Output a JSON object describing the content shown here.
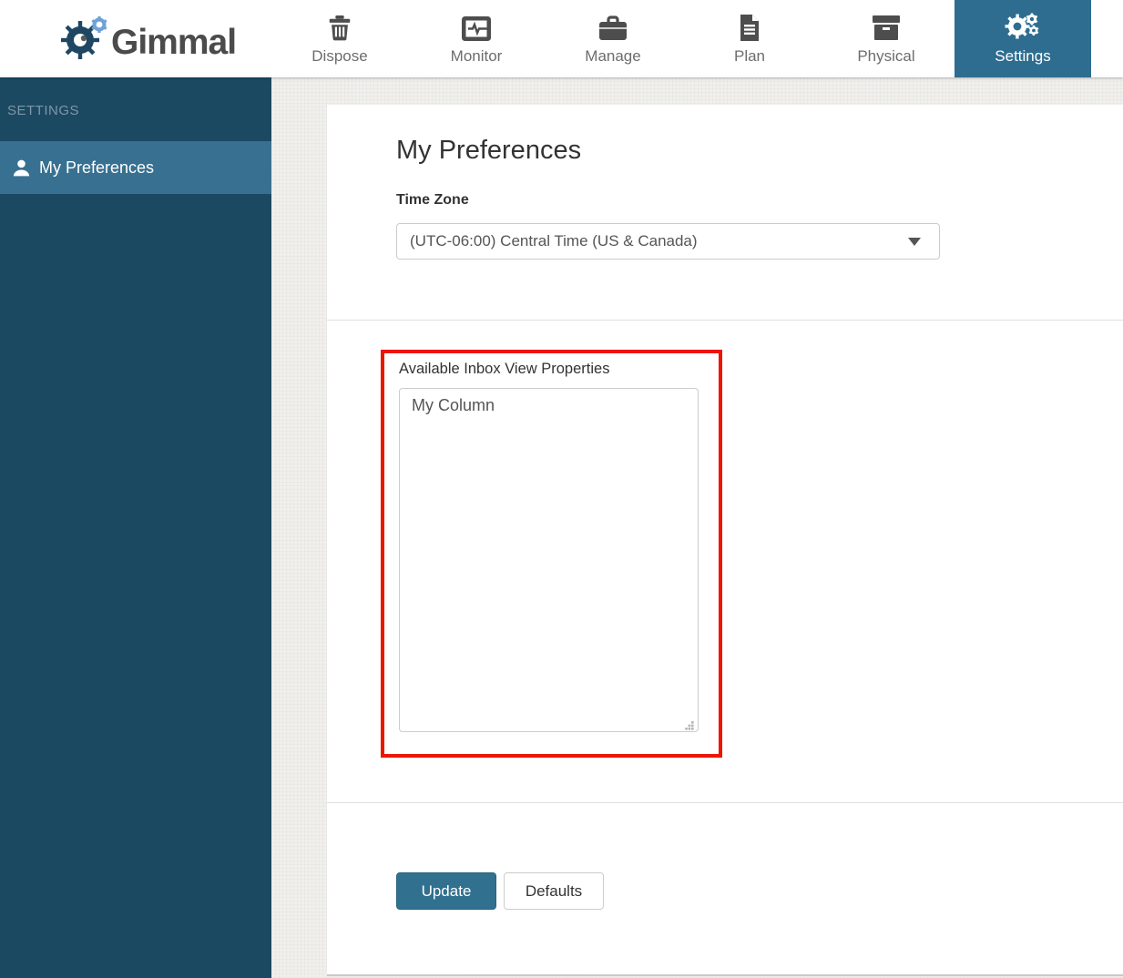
{
  "brand": {
    "name": "Gimmal"
  },
  "nav": {
    "items": [
      {
        "label": "Dispose",
        "icon": "trash-icon",
        "active": false
      },
      {
        "label": "Monitor",
        "icon": "monitor-icon",
        "active": false
      },
      {
        "label": "Manage",
        "icon": "briefcase-icon",
        "active": false
      },
      {
        "label": "Plan",
        "icon": "document-icon",
        "active": false
      },
      {
        "label": "Physical",
        "icon": "archive-box-icon",
        "active": false
      },
      {
        "label": "Settings",
        "icon": "gears-icon",
        "active": true
      }
    ]
  },
  "sidebar": {
    "header": "SETTINGS",
    "items": [
      {
        "label": "My Preferences",
        "icon": "user-icon",
        "active": true
      }
    ]
  },
  "main": {
    "title": "My Preferences",
    "time_zone": {
      "label": "Time Zone",
      "selected": "(UTC-06:00) Central Time (US & Canada)"
    },
    "inbox_properties": {
      "label": "Available Inbox View Properties",
      "items": [
        "My Column"
      ]
    },
    "actions": {
      "update": "Update",
      "defaults": "Defaults"
    }
  },
  "colors": {
    "accent_teal": "#31708f",
    "active_tab": "#2e6d90",
    "sidebar_bg": "#1c4962",
    "sidebar_active_bg": "#387091",
    "annotation_red": "#ed1500",
    "icon_gray": "#4d4d4d",
    "text_dark": "#333333"
  }
}
